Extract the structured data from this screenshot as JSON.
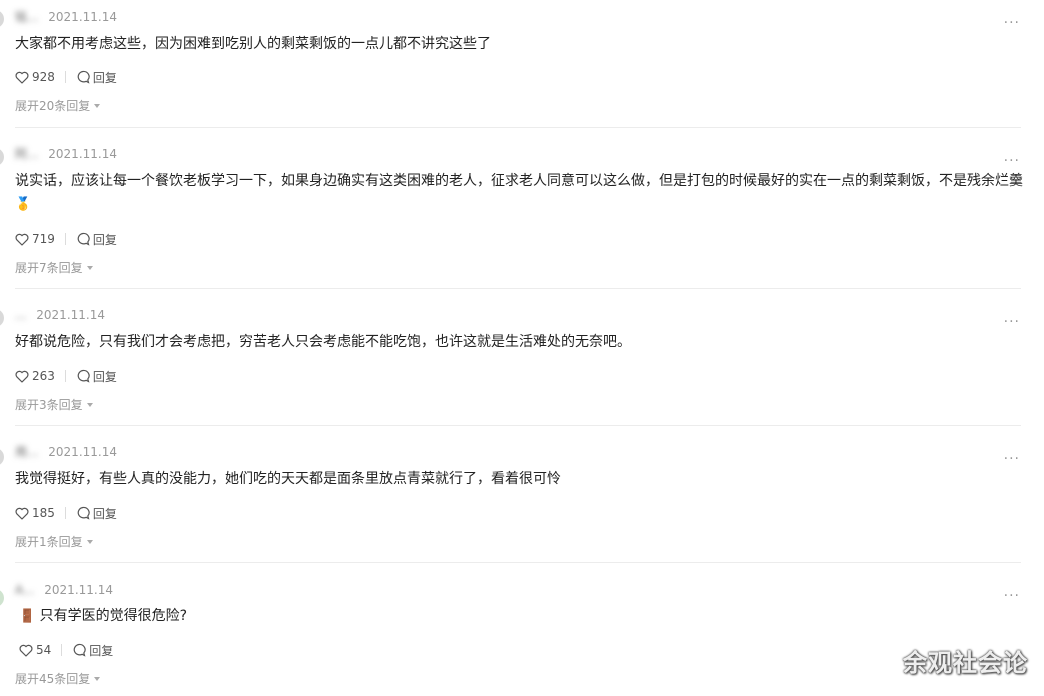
{
  "comments": [
    {
      "author": "铭...",
      "date": "2021.11.14",
      "text": "大家都不用考虑这些，因为困难到吃别人的剩菜剩饭的一点儿都不讲究这些了",
      "likes": "928",
      "reply_label": "回复",
      "expand": "展开20条回复"
    },
    {
      "author": "阿...",
      "date": "2021.11.14",
      "text": "说实话，应该让每一个餐饮老板学习一下，如果身边确实有这类困难的老人，征求老人同意可以这么做，但是打包的时候最好的实在一点的剩菜剩饭，不是残余烂羹",
      "likes": "719",
      "reply_label": "回复",
      "expand": "展开7条回复"
    },
    {
      "author": "...",
      "date": "2021.11.14",
      "text": "好都说危险，只有我们才会考虑把，穷苦老人只会考虑能不能吃饱，也许这就是生活难处的无奈吧。",
      "likes": "263",
      "reply_label": "回复",
      "expand": "展开3条回复"
    },
    {
      "author": "用...",
      "date": "2021.11.14",
      "text": "我觉得挺好，有些人真的没能力，她们吃的天天都是面条里放点青菜就行了，看着很可怜",
      "likes": "185",
      "reply_label": "回复",
      "expand": "展开1条回复"
    },
    {
      "author": "A...",
      "date": "2021.11.14",
      "text": "只有学医的觉得很危险?",
      "likes": "54",
      "reply_label": "回复",
      "expand": "展开45条回复"
    }
  ],
  "watermark": "余观社会论",
  "icons": {
    "like": "heart-icon",
    "reply": "comment-bubble-icon",
    "more": "more-dots-icon",
    "medal": "medal-emoji-icon",
    "door": "door-emoji-icon"
  }
}
